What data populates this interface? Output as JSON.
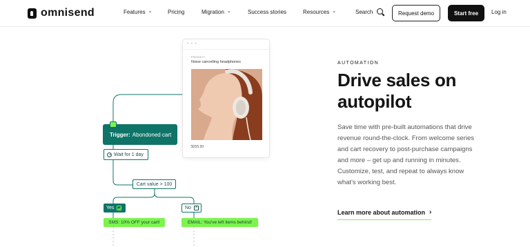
{
  "brand": {
    "name": "omnisend"
  },
  "nav": {
    "items": [
      {
        "label": "Features",
        "has_dropdown": true
      },
      {
        "label": "Pricing",
        "has_dropdown": false
      },
      {
        "label": "Migration",
        "has_dropdown": true
      },
      {
        "label": "Success stories",
        "has_dropdown": false
      },
      {
        "label": "Resources",
        "has_dropdown": true
      }
    ],
    "search_label": "Search",
    "request_demo_label": "Request demo",
    "start_free_label": "Start free",
    "login_label": "Log in",
    "chevron": "⌄"
  },
  "illustration": {
    "card": {
      "dots": "• • •",
      "eyebrow": "PRODUCT",
      "title": "Noise cancelling headphones",
      "price": "$255.99"
    },
    "flow": {
      "trigger_bold": "Trigger:",
      "trigger_text": "Abondoned cart",
      "wait": "Wait for 1 day",
      "condition": "Cart value > 100",
      "yes": "Yes",
      "no": "No",
      "sms": "SMS: 10% OFF your cart!",
      "email": "EMAIL: You've left items behind!"
    }
  },
  "hero": {
    "eyebrow": "AUTOMATION",
    "headline": "Drive sales on autopilot",
    "body": "Save time with pre-built automations that drive revenue round-the-clock. From welcome series and cart recovery to post-purchase campaigns and more – get up and running in minutes. Customize, test, and repeat to always know what's working best.",
    "cta": "Learn more about automation",
    "cta_chevron": "›"
  },
  "colors": {
    "accent_green": "#7cf44e",
    "teal": "#0e7468",
    "dark": "#111111"
  },
  "icons": [
    "logo-icon",
    "chevron-down-icon",
    "search-icon",
    "clock-icon",
    "check-icon",
    "x-icon",
    "chevron-right-icon"
  ]
}
